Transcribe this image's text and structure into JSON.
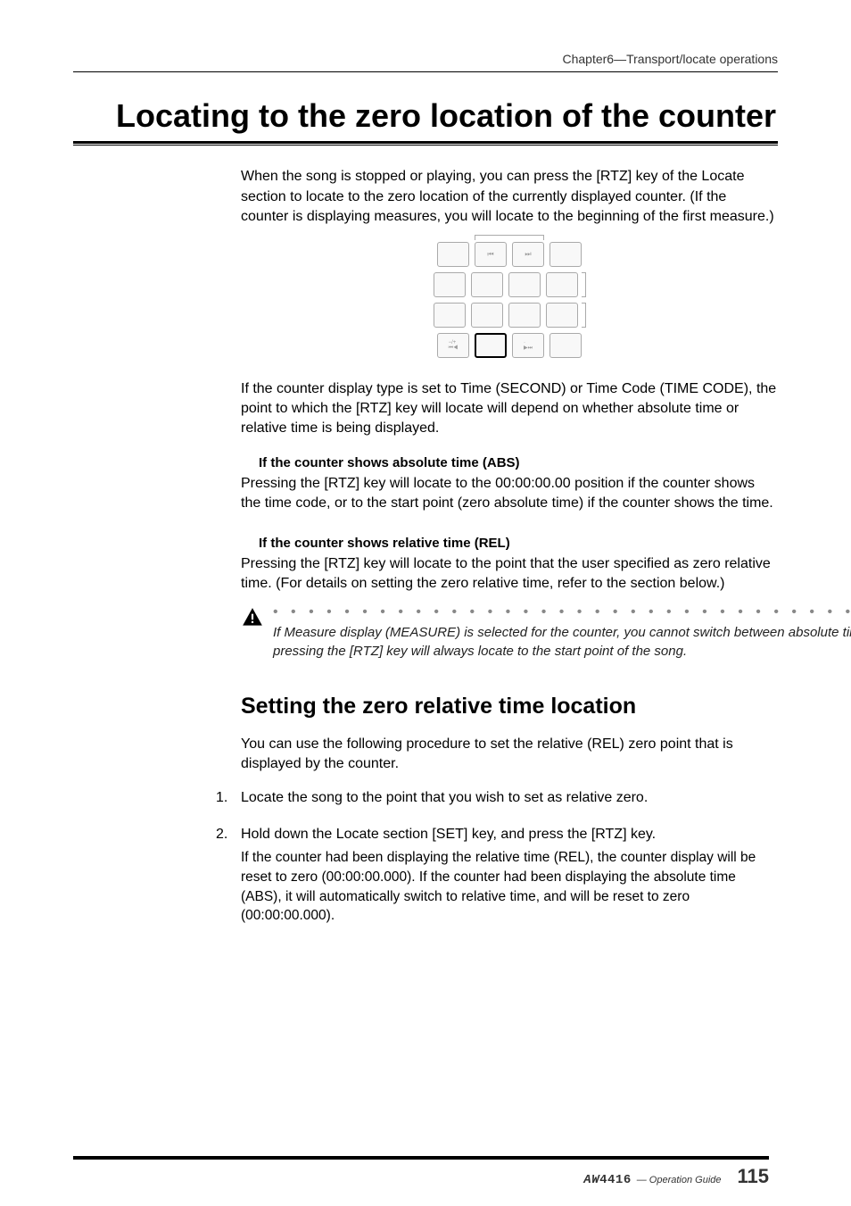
{
  "chapter": "Chapter6—Transport/locate operations",
  "heading": "Locating to the zero location of the counter",
  "intro": "When the song is stopped or playing, you can press the [RTZ] key of the Locate section to locate to the zero location of the currently displayed counter. (If the counter is displaying measures, you will locate to the beginning of the first measure.)",
  "diagram": {
    "rows": [
      {
        "buttons": [
          " ",
          "⏮",
          "⏭",
          " "
        ]
      },
      {
        "buttons": [
          " ",
          " ",
          " ",
          " "
        ],
        "bracketRight": true
      },
      {
        "buttons": [
          " ",
          " ",
          " ",
          " "
        ],
        "bracketRight": true
      },
      {
        "buttons": [
          "−/+ ⏮◀",
          " ",
          "· ▶⏭",
          " "
        ],
        "highlight": 1
      }
    ]
  },
  "para2": "If the counter display type is set to Time (SECOND) or Time Code (TIME CODE), the point to which the [RTZ] key will locate will depend on whether absolute time or relative time is being displayed.",
  "abs": {
    "title": "If the counter shows absolute time (ABS)",
    "body": "Pressing the [RTZ] key will locate to the 00:00:00.00 position if the counter shows the time code, or to the start point (zero absolute time) if the counter shows the time."
  },
  "rel": {
    "title": "If the counter shows relative time (REL)",
    "body": "Pressing the [RTZ] key will locate to the point that the user specified as zero relative time. (For details on setting the zero relative time, refer to the section below.)"
  },
  "note": "If Measure display (MEASURE) is selected for the counter, you cannot switch between absolute time and relative time; pressing the [RTZ] key will always locate to the start point of the song.",
  "subheading": "Setting the zero relative time location",
  "subintro": "You can use the following procedure to set the relative (REL) zero point that is displayed by the counter.",
  "steps": [
    {
      "num": "1.",
      "main": "Locate the song to the point that you wish to set as relative zero.",
      "detail": ""
    },
    {
      "num": "2.",
      "main": "Hold down the Locate section [SET] key, and press the [RTZ] key.",
      "detail": "If the counter had been displaying the relative time (REL), the counter display will be reset to zero (00:00:00.000). If the counter had been displaying the absolute time (ABS), it will automatically switch to relative time, and will be reset to zero (00:00:00.000)."
    }
  ],
  "footer": {
    "model": "4416",
    "guide": "— Operation Guide",
    "page": "115"
  }
}
